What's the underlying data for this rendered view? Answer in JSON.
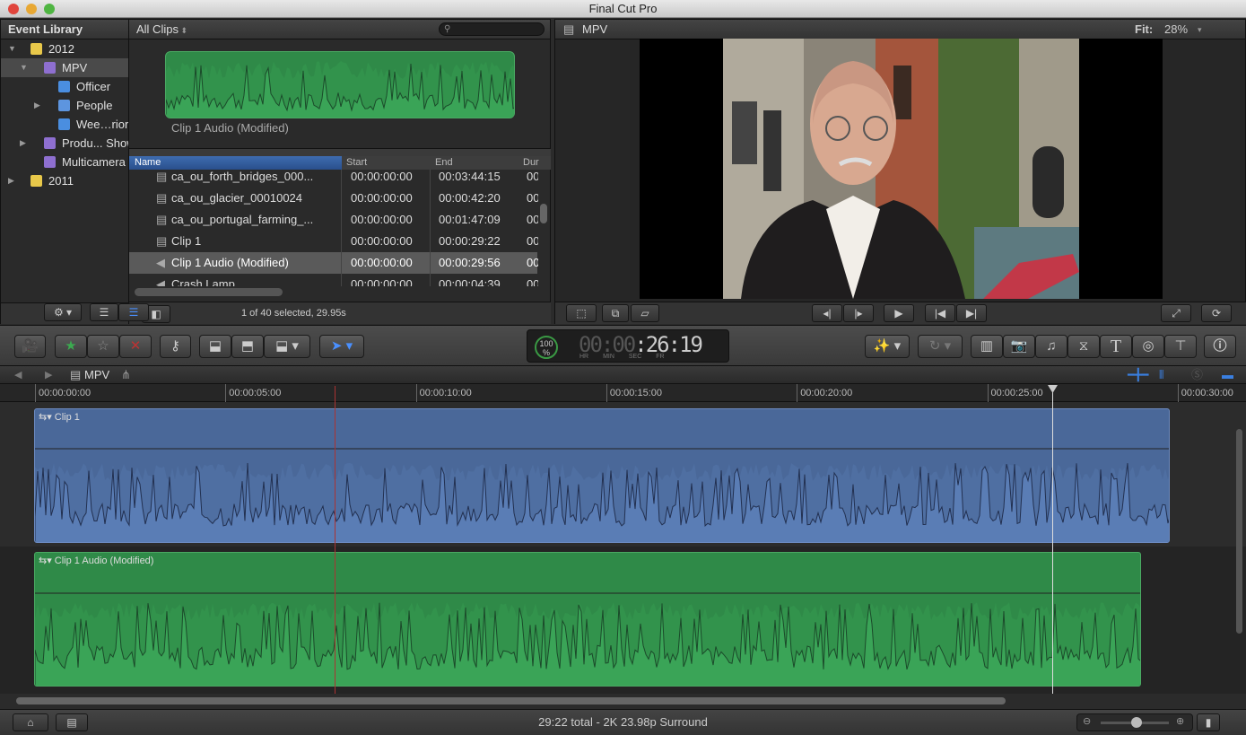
{
  "window": {
    "title": "Final Cut Pro"
  },
  "library": {
    "title": "Event Library",
    "items": [
      {
        "label": "2012",
        "type": "year",
        "expanded": true
      },
      {
        "label": "MPV",
        "type": "event",
        "expanded": true,
        "selected": true
      },
      {
        "label": "Officer",
        "type": "keyword"
      },
      {
        "label": "People",
        "type": "folder",
        "expanded": false
      },
      {
        "label": "Wee…riors",
        "type": "keyword"
      },
      {
        "label": "Produ... Show",
        "type": "event",
        "expanded": false
      },
      {
        "label": "Multicamera",
        "type": "event"
      },
      {
        "label": "2011",
        "type": "year",
        "expanded": false
      }
    ]
  },
  "browser": {
    "filter": "All Clips",
    "search_placeholder": "",
    "filmstrip_label": "Clip 1 Audio (Modified)",
    "columns": [
      "Name",
      "Start",
      "End",
      "Dur"
    ],
    "rows": [
      {
        "name": "ca_ou_forth_bridges_000...",
        "start": "00:00:00:00",
        "end": "00:03:44:15",
        "dur": "00",
        "kind": "video"
      },
      {
        "name": "ca_ou_glacier_00010024",
        "start": "00:00:00:00",
        "end": "00:00:42:20",
        "dur": "00",
        "kind": "video"
      },
      {
        "name": "ca_ou_portugal_farming_...",
        "start": "00:00:00:00",
        "end": "00:01:47:09",
        "dur": "00",
        "kind": "video"
      },
      {
        "name": "Clip 1",
        "start": "00:00:00:00",
        "end": "00:00:29:22",
        "dur": "00",
        "kind": "video"
      },
      {
        "name": "Clip 1 Audio (Modified)",
        "start": "00:00:00:00",
        "end": "00:00:29:56",
        "dur": "00",
        "kind": "audio",
        "selected": true
      },
      {
        "name": "Crash Lamp",
        "start": "00:00:00:00",
        "end": "00:00:04:39",
        "dur": "00",
        "kind": "audio"
      }
    ],
    "status": "1 of 40 selected, 29.95s"
  },
  "viewer": {
    "title": "MPV",
    "fit_label": "Fit:",
    "zoom": "28%"
  },
  "toolbar": {
    "timecode": {
      "hr": "00",
      "min": "00",
      "sec": "26",
      "fr": "19",
      "labels": [
        "HR",
        "MIN",
        "SEC",
        "FR"
      ]
    },
    "background_tasks": "100",
    "background_tasks_unit": "%"
  },
  "timeline": {
    "project": "MPV",
    "ruler": [
      "00:00:00:00",
      "00:00:05:00",
      "00:00:10:00",
      "00:00:15:00",
      "00:00:20:00",
      "00:00:25:00",
      "00:00:30:00"
    ],
    "clips": [
      {
        "label": "Clip 1",
        "color": "#4a6899"
      },
      {
        "label": "Clip 1 Audio (Modified)",
        "color": "#2f8a48"
      }
    ],
    "status": "29:22 total - 2K 23.98p Surround"
  }
}
